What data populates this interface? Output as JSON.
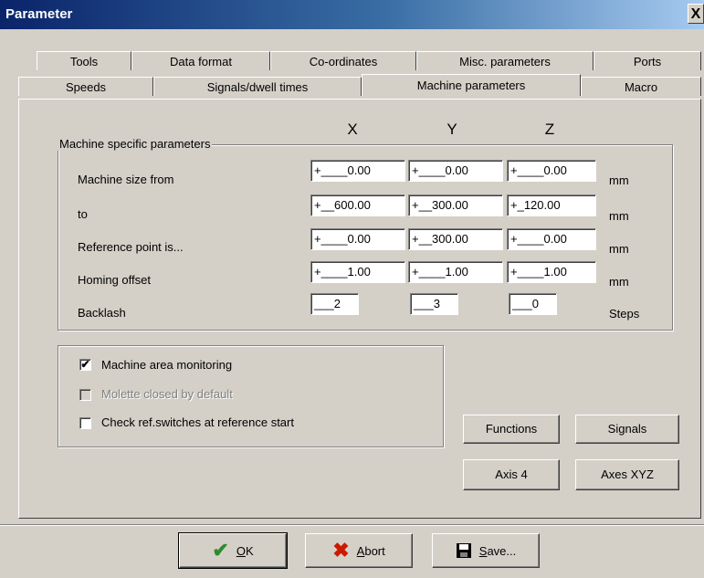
{
  "window": {
    "title": "Parameter",
    "close_glyph": "X"
  },
  "tabs_row1": [
    {
      "label": "Tools"
    },
    {
      "label": "Data format"
    },
    {
      "label": "Co-ordinates"
    },
    {
      "label": "Misc. parameters"
    },
    {
      "label": "Ports"
    }
  ],
  "tabs_row2": [
    {
      "label": "Speeds"
    },
    {
      "label": "Signals/dwell times"
    },
    {
      "label": "Machine parameters",
      "active": true
    },
    {
      "label": "Macro"
    }
  ],
  "columns": {
    "x": "X",
    "y": "Y",
    "z": "Z"
  },
  "machine_group": {
    "label": "Machine specific parameters",
    "rows": [
      {
        "label": "Machine size from",
        "x": "+____0.00",
        "y": "+____0.00",
        "z": "+____0.00",
        "unit": "mm"
      },
      {
        "label": "to",
        "x": "+__600.00",
        "y": "+__300.00",
        "z": "+_120.00",
        "unit": "mm"
      },
      {
        "label": "Reference point is...",
        "x": "+____0.00",
        "y": "+__300.00",
        "z": "+____0.00",
        "unit": "mm"
      },
      {
        "label": "Homing offset",
        "x": "+____1.00",
        "y": "+____1.00",
        "z": "+____1.00",
        "unit": "mm"
      },
      {
        "label": "Backlash",
        "x": "___2",
        "y": "___3",
        "z": "___0",
        "unit": "Steps"
      }
    ]
  },
  "options": [
    {
      "label": "Machine area monitoring",
      "checked": true,
      "enabled": true
    },
    {
      "label": "Molette closed by default",
      "checked": false,
      "enabled": false
    },
    {
      "label": "Check ref.switches at reference start",
      "checked": false,
      "enabled": true
    }
  ],
  "side_buttons": {
    "functions": "Functions",
    "signals": "Signals",
    "axis4": "Axis 4",
    "axes_xyz": "Axes XYZ"
  },
  "footer": {
    "ok": {
      "mnemonic": "O",
      "rest": "K",
      "icon": "checkmark-icon",
      "color": "#2e8b2e"
    },
    "abort": {
      "mnemonic": "A",
      "rest": "bort",
      "icon": "x-icon",
      "color": "#cc1a00"
    },
    "save": {
      "mnemonic": "S",
      "rest": "ave...",
      "icon": "floppy-disk-icon"
    }
  }
}
